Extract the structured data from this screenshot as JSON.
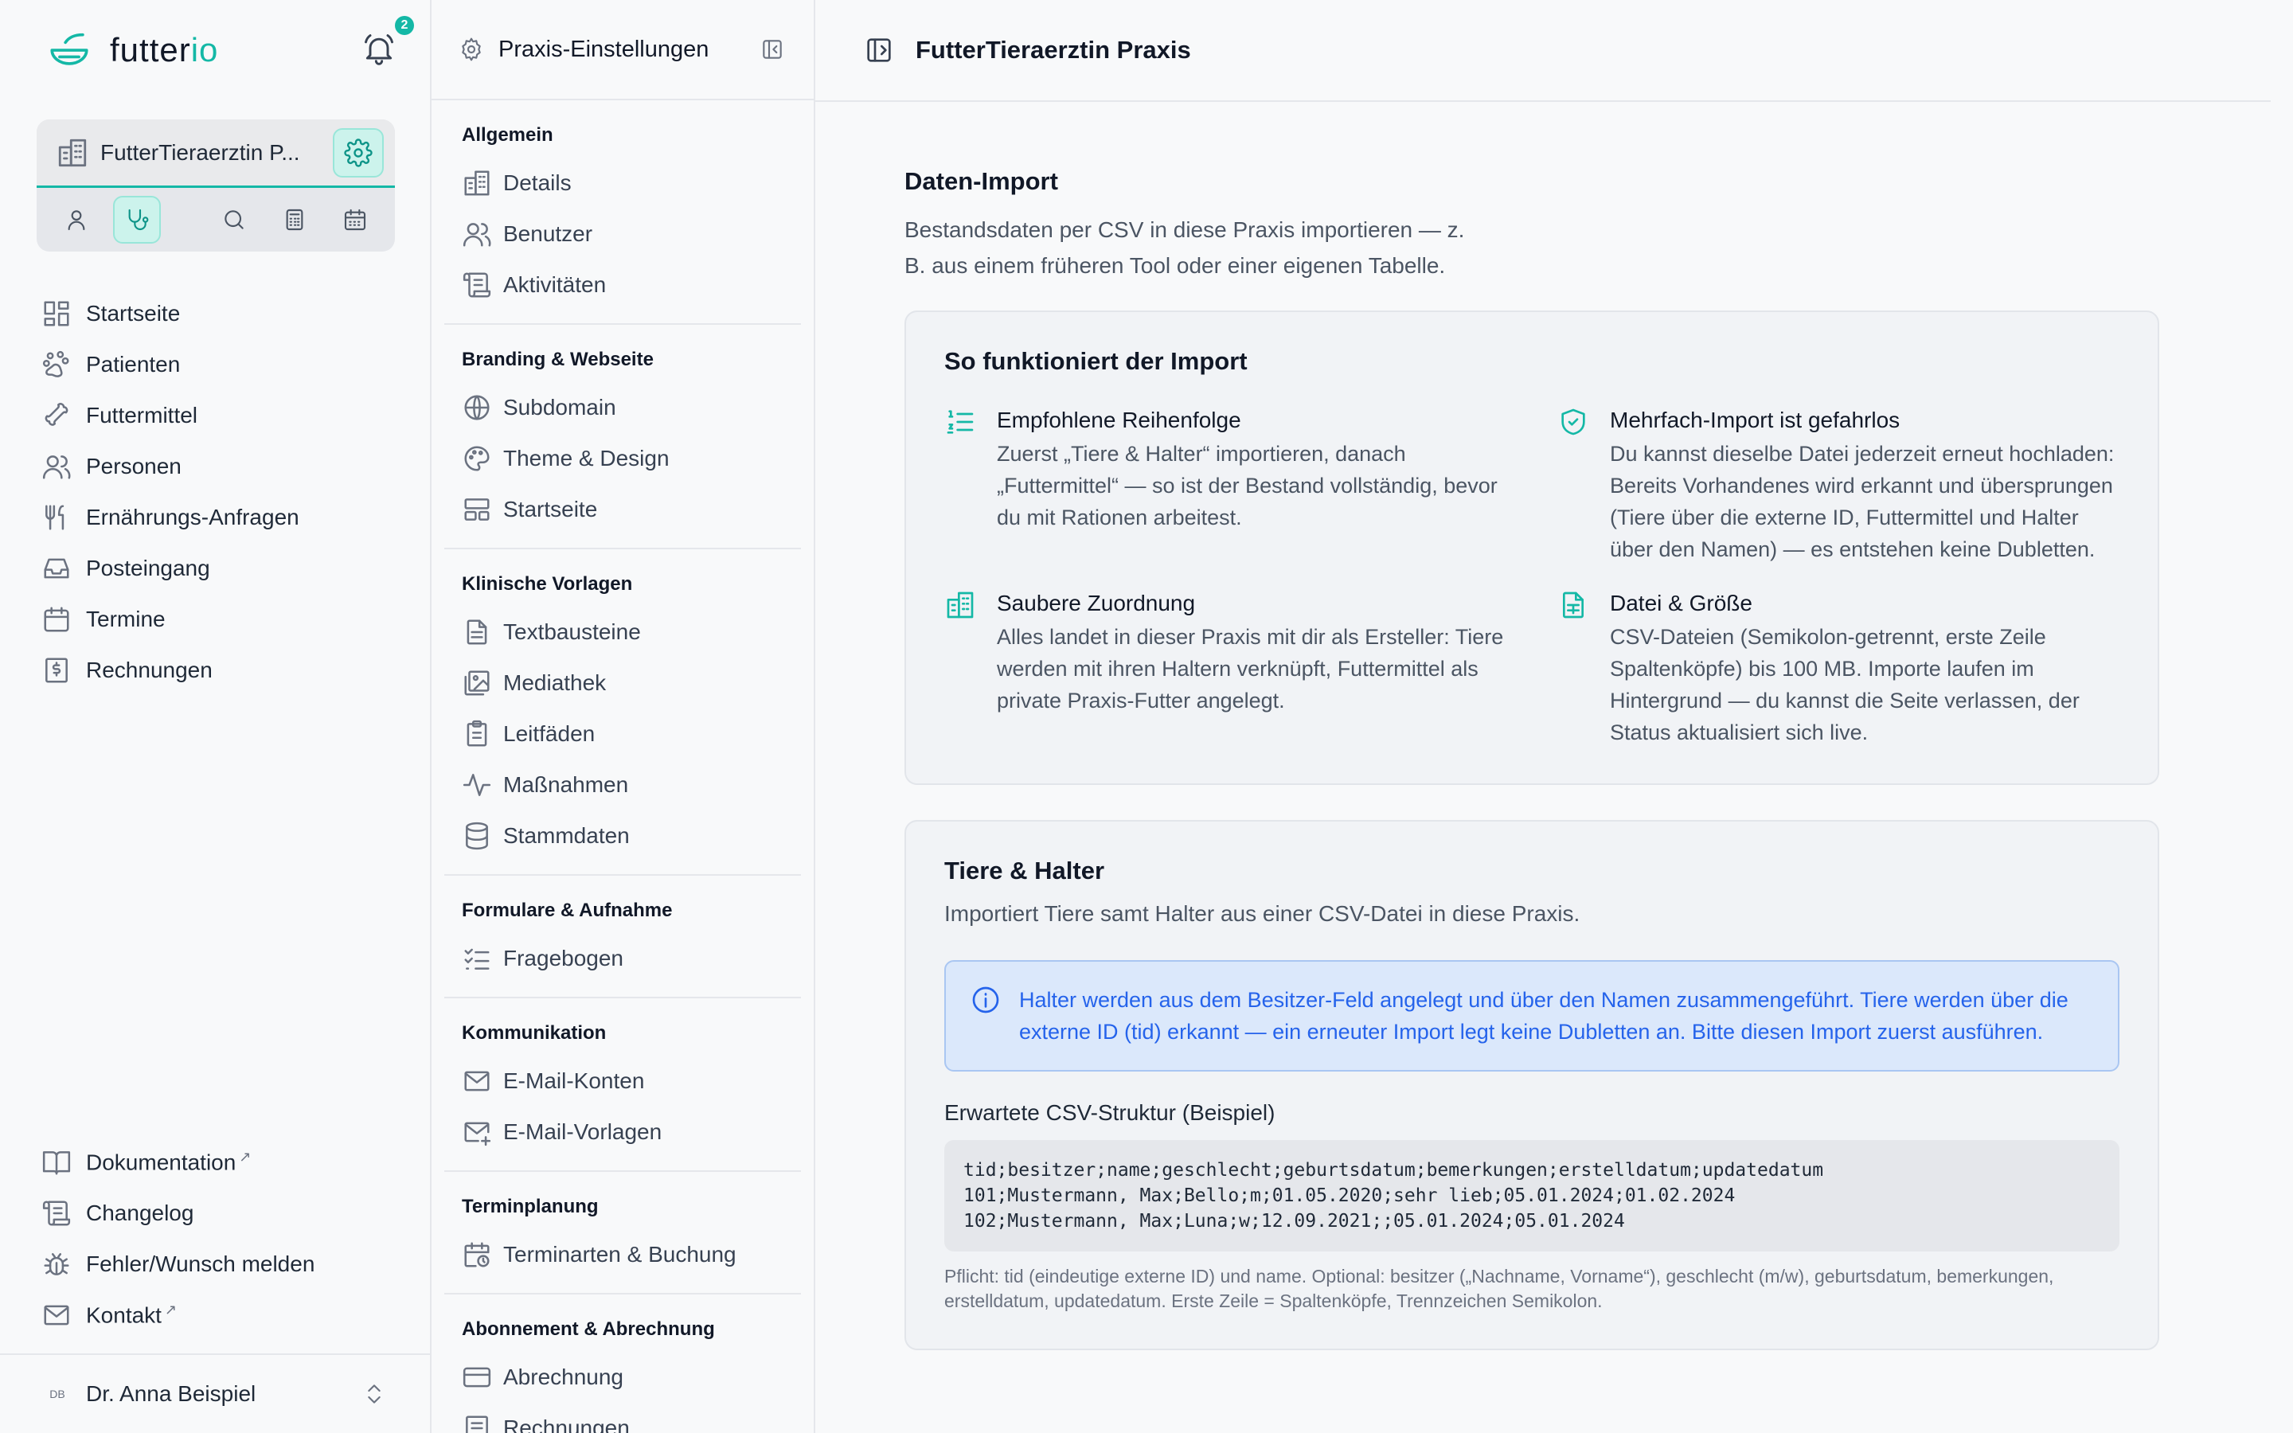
{
  "brand": {
    "name_left": "futter",
    "name_right": "io"
  },
  "notifications": {
    "count": "2"
  },
  "practice": {
    "name": "FutterTieraerztin P..."
  },
  "nav": {
    "items": [
      {
        "label": "Startseite"
      },
      {
        "label": "Patienten"
      },
      {
        "label": "Futtermittel"
      },
      {
        "label": "Personen"
      },
      {
        "label": "Ernährungs-Anfragen"
      },
      {
        "label": "Posteingang"
      },
      {
        "label": "Termine"
      },
      {
        "label": "Rechnungen"
      }
    ],
    "bottom": [
      {
        "label": "Dokumentation"
      },
      {
        "label": "Changelog"
      },
      {
        "label": "Fehler/Wunsch melden"
      },
      {
        "label": "Kontakt"
      }
    ],
    "external_mark": "↗"
  },
  "user": {
    "initials": "DB",
    "name": "Dr. Anna Beispiel"
  },
  "settings": {
    "title": "Praxis-Einstellungen",
    "groups": [
      {
        "title": "Allgemein",
        "items": [
          "Details",
          "Benutzer",
          "Aktivitäten"
        ]
      },
      {
        "title": "Branding & Webseite",
        "items": [
          "Subdomain",
          "Theme & Design",
          "Startseite"
        ]
      },
      {
        "title": "Klinische Vorlagen",
        "items": [
          "Textbausteine",
          "Mediathek",
          "Leitfäden",
          "Maßnahmen",
          "Stammdaten"
        ]
      },
      {
        "title": "Formulare & Aufnahme",
        "items": [
          "Fragebogen"
        ]
      },
      {
        "title": "Kommunikation",
        "items": [
          "E-Mail-Konten",
          "E-Mail-Vorlagen"
        ]
      },
      {
        "title": "Terminplanung",
        "items": [
          "Terminarten & Buchung"
        ]
      },
      {
        "title": "Abonnement & Abrechnung",
        "items": [
          "Abrechnung",
          "Rechnungen"
        ]
      }
    ]
  },
  "main": {
    "title": "FutterTieraerztin Praxis",
    "section": {
      "title": "Daten-Import",
      "description": "Bestandsdaten per CSV in diese Praxis importieren — z. B. aus einem früheren Tool oder einer eigenen Tabelle."
    },
    "howto": {
      "title": "So funktioniert der Import",
      "features": [
        {
          "title": "Empfohlene Reihenfolge",
          "body": "Zuerst „Tiere & Halter“ importieren, danach „Futtermittel“ — so ist der Bestand vollständig, bevor du mit Rationen arbeitest."
        },
        {
          "title": "Mehrfach-Import ist gefahrlos",
          "body": "Du kannst dieselbe Datei jederzeit erneut hochladen: Bereits Vorhandenes wird erkannt und übersprungen (Tiere über die externe ID, Futtermittel und Halter über den Namen) — es entstehen keine Dubletten."
        },
        {
          "title": "Saubere Zuordnung",
          "body": "Alles landet in dieser Praxis mit dir als Ersteller: Tiere werden mit ihren Haltern verknüpft, Futtermittel als private Praxis-Futter angelegt."
        },
        {
          "title": "Datei & Größe",
          "body": "CSV-Dateien (Semikolon-getrennt, erste Zeile Spaltenköpfe) bis 100 MB. Importe laufen im Hintergrund — du kannst die Seite verlassen, der Status aktualisiert sich live."
        }
      ]
    },
    "animals": {
      "title": "Tiere & Halter",
      "description": "Importiert Tiere samt Halter aus einer CSV-Datei in diese Praxis.",
      "info": "Halter werden aus dem Besitzer-Feld angelegt und über den Namen zusammengeführt. Tiere werden über die externe ID (tid) erkannt — ein erneuter Import legt keine Dubletten an. Bitte diesen Import zuerst ausführen.",
      "code_label": "Erwartete CSV-Struktur (Beispiel)",
      "code": "tid;besitzer;name;geschlecht;geburtsdatum;bemerkungen;erstelldatum;updatedatum\n101;Mustermann, Max;Bello;m;01.05.2020;sehr lieb;05.01.2024;01.02.2024\n102;Mustermann, Max;Luna;w;12.09.2021;;05.01.2024;05.01.2024",
      "footnote": "Pflicht: tid (eindeutige externe ID) und name. Optional: besitzer („Nachname, Vorname“), geschlecht (m/w), geburtsdatum, bemerkungen, erstelldatum, updatedatum. Erste Zeile = Spaltenköpfe, Trennzeichen Semikolon."
    }
  }
}
